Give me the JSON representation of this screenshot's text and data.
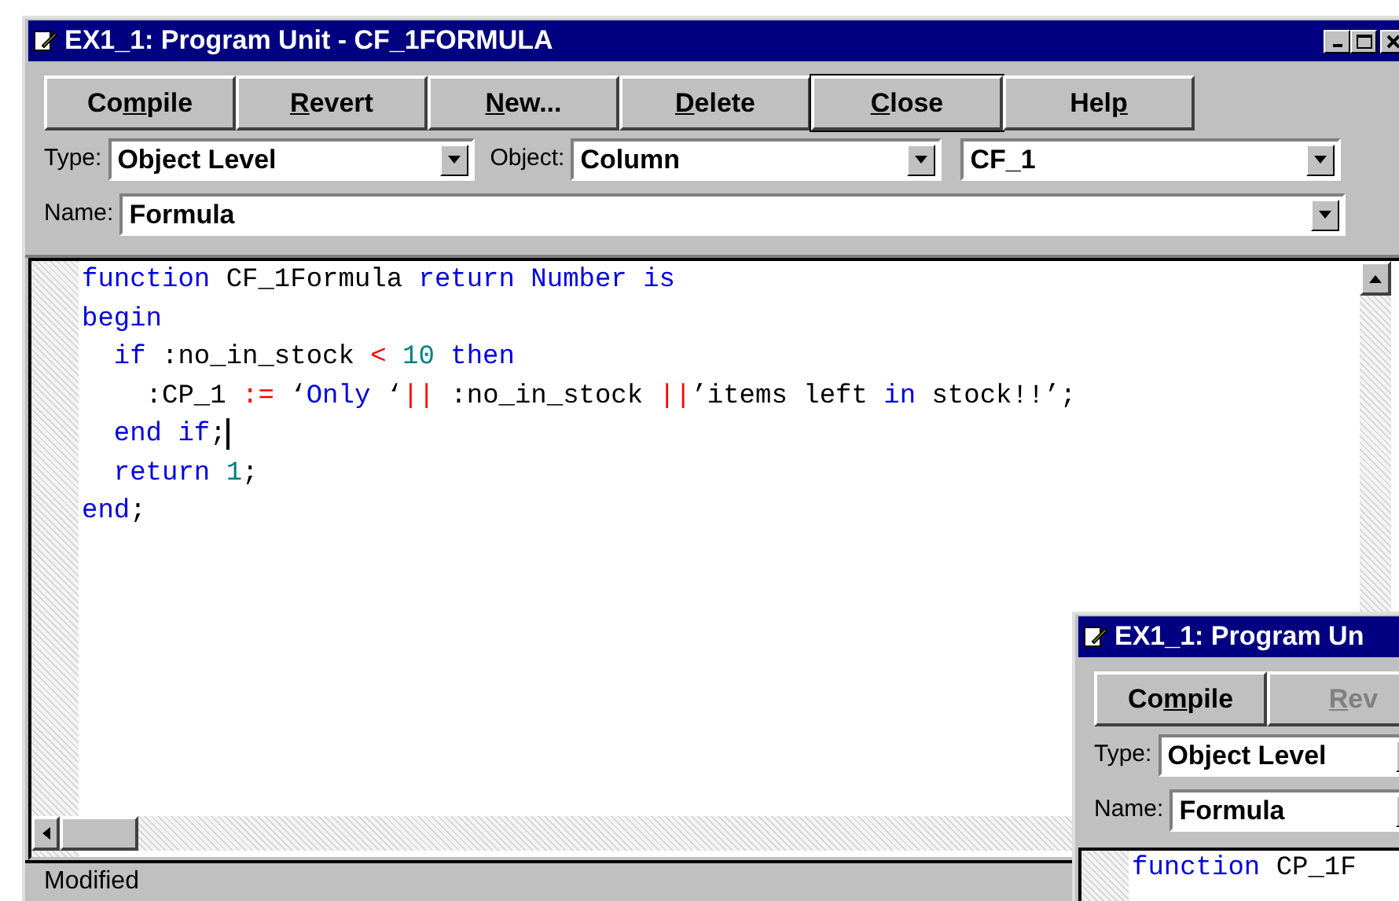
{
  "window": {
    "title": "EX1_1: Program Unit - CF_1FORMULA"
  },
  "buttons": [
    {
      "before": "Co",
      "mnemonic": "m",
      "after": "pile",
      "default": false,
      "disabled": false
    },
    {
      "mnemonic": "R",
      "after": "evert",
      "default": false,
      "disabled": false
    },
    {
      "mnemonic": "N",
      "after": "ew...",
      "default": false,
      "disabled": false
    },
    {
      "mnemonic": "D",
      "after": "elete",
      "default": false,
      "disabled": false
    },
    {
      "mnemonic": "C",
      "after": "lose",
      "default": true,
      "disabled": false
    },
    {
      "before": "Hel",
      "mnemonic": "p",
      "default": false,
      "disabled": false
    }
  ],
  "type_label": "Type:",
  "type_value": "Object Level",
  "object_label": "Object:",
  "object_value": "Column",
  "object_name": "CF_1",
  "name_label": "Name:",
  "name_value": "Formula",
  "code": [
    [
      {
        "kind": "keyword",
        "text": "function"
      },
      {
        "kind": "text",
        "text": " CF_1Formula "
      },
      {
        "kind": "keyword",
        "text": "return Number is"
      }
    ],
    [
      {
        "kind": "keyword",
        "text": "begin"
      }
    ],
    [
      {
        "kind": "keyword",
        "text": "  if"
      },
      {
        "kind": "text",
        "text": " :no_in_stock "
      },
      {
        "kind": "operator",
        "text": "<"
      },
      {
        "kind": "number",
        "text": " 10"
      },
      {
        "kind": "keyword",
        "text": " then"
      }
    ],
    [
      {
        "kind": "text",
        "text": "    :CP_1 "
      },
      {
        "kind": "operator",
        "text": ":="
      },
      {
        "kind": "text",
        "text": " ‘"
      },
      {
        "kind": "keyword",
        "text": "Only"
      },
      {
        "kind": "text",
        "text": " ‘"
      },
      {
        "kind": "operator",
        "text": "||"
      },
      {
        "kind": "text",
        "text": " :no_in_stock "
      },
      {
        "kind": "operator",
        "text": "||"
      },
      {
        "kind": "text",
        "text": "’items left "
      },
      {
        "kind": "keyword",
        "text": "in"
      },
      {
        "kind": "text",
        "text": " stock!!’;"
      }
    ],
    [
      {
        "kind": "keyword",
        "text": "  end if"
      },
      {
        "kind": "text",
        "text": ";"
      },
      {
        "kind": "cursor"
      }
    ],
    [
      {
        "kind": "keyword",
        "text": "  return"
      },
      {
        "kind": "number",
        "text": " 1"
      },
      {
        "kind": "text",
        "text": ";"
      }
    ],
    [
      {
        "kind": "keyword",
        "text": "end"
      },
      {
        "kind": "text",
        "text": ";"
      }
    ]
  ],
  "status_bar": "Modified",
  "second_window": {
    "title": "EX1_1: Program Un",
    "buttons": [
      {
        "before": "Co",
        "mnemonic": "m",
        "after": "pile",
        "default": false,
        "disabled": false
      },
      {
        "mnemonic": "R",
        "after": "ev",
        "default": false,
        "disabled": true
      }
    ],
    "type_label": "Type:",
    "type_value": "Object Level",
    "name_label": "Name:",
    "name_value": "Formula",
    "code": [
      [
        {
          "kind": "keyword",
          "text": "function"
        },
        {
          "kind": "text",
          "text": " CP_1F"
        }
      ]
    ]
  }
}
